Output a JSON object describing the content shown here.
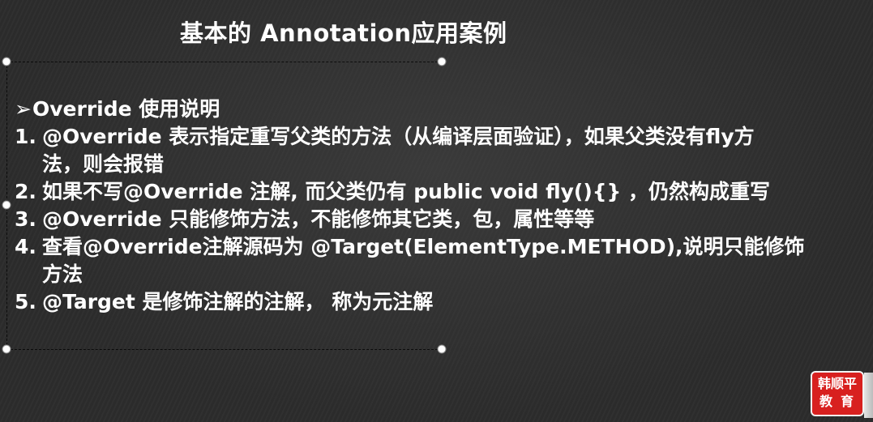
{
  "slide": {
    "title": "基本的 Annotation应用案例",
    "heading": "Override 使用说明",
    "items": [
      {
        "num": "1.",
        "lines": [
          "@Override 表示指定重写父类的方法（从编译层面验证），如果父类没有fly方",
          "法，则会报错"
        ]
      },
      {
        "num": "2.",
        "lines": [
          "如果不写@Override 注解, 而父类仍有 public void fly(){}  ，仍然构成重写"
        ]
      },
      {
        "num": "3.",
        "lines": [
          "@Override 只能修饰方法，不能修饰其它类，包，属性等等"
        ]
      },
      {
        "num": "4.",
        "lines": [
          "查看@Override注解源码为 @Target(ElementType.METHOD),说明只能修饰",
          "方法"
        ]
      },
      {
        "num": "5.",
        "lines": [
          "@Target 是修饰注解的注解，  称为元注解"
        ]
      }
    ]
  },
  "logo": {
    "line1": "韩顺平",
    "line2": "教育",
    "color": "#d8201f"
  },
  "icons": {
    "bullet": "arrowhead-bullet-icon"
  }
}
